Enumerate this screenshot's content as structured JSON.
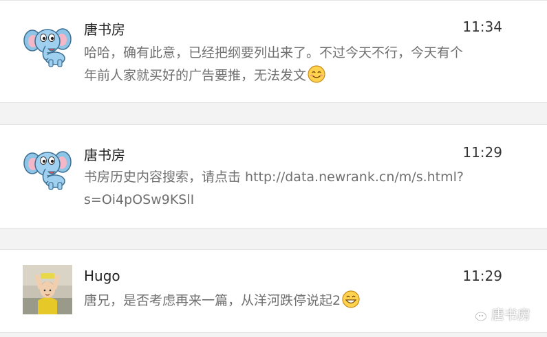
{
  "messages": [
    {
      "author": "唐书房",
      "time": "11:34",
      "text": "哈哈，确有此意，已经把纲要列出来了。不过今天不行，今天有个年前人家就买好的广告要推，无法发文",
      "emoji": "smile-emoji",
      "avatar": "elephant-avatar"
    },
    {
      "author": "唐书房",
      "time": "11:29",
      "text": "书房历史内容搜索，请点击 http://data.newrank.cn/m/s.html?s=Oi4pOSw9KSlI",
      "avatar": "elephant-avatar"
    },
    {
      "author": "Hugo",
      "time": "11:29",
      "text": "唐兄，是否考虑再来一篇，从洋河跌停说起2",
      "emoji": "grin-emoji",
      "avatar": "child-photo-avatar"
    }
  ],
  "watermark": {
    "label": "唐书房",
    "icon": "wechat-icon"
  },
  "colors": {
    "name": "#222222",
    "text": "#707070",
    "divider": "#e4e4e4",
    "background": "#f3f3f3"
  }
}
